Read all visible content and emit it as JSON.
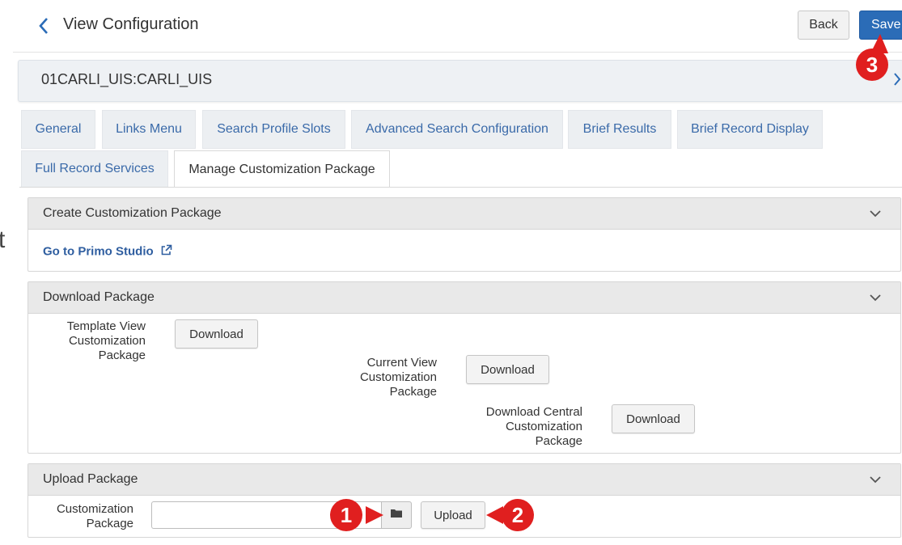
{
  "header": {
    "title": "View Configuration",
    "back_label": "Back",
    "save_label": "Save"
  },
  "view_bar": {
    "code": "01CARLI_UIS:CARLI_UIS"
  },
  "tabs": [
    {
      "label": "General"
    },
    {
      "label": "Links Menu"
    },
    {
      "label": "Search Profile Slots"
    },
    {
      "label": "Advanced Search Configuration"
    },
    {
      "label": "Brief Results"
    },
    {
      "label": "Brief Record Display"
    },
    {
      "label": "Full Record Services"
    },
    {
      "label": "Manage Customization Package",
      "active": true
    }
  ],
  "sections": {
    "create": {
      "title": "Create Customization Package",
      "studio_link": "Go to Primo Studio"
    },
    "download": {
      "title": "Download Package",
      "template": {
        "label": "Template View Customization Package",
        "button": "Download"
      },
      "current": {
        "label": "Current View Customization Package",
        "button": "Download"
      },
      "central": {
        "label": "Download Central Customization Package",
        "button": "Download"
      }
    },
    "upload": {
      "title": "Upload Package",
      "field_label": "Customization Package",
      "upload_button": "Upload"
    }
  },
  "annotations": {
    "badge1": "1",
    "badge2": "2",
    "badge3": "3",
    "color": "#e01f1f"
  },
  "colors": {
    "accent": "#2b6cb7",
    "link": "#2f5ea0",
    "panel_header": "#e9e9e9"
  },
  "icons": {
    "back": "chevron-left-icon",
    "collapse": "chevron-down-icon",
    "external": "external-link-icon",
    "browse": "folder-icon"
  },
  "stray_char": "t"
}
